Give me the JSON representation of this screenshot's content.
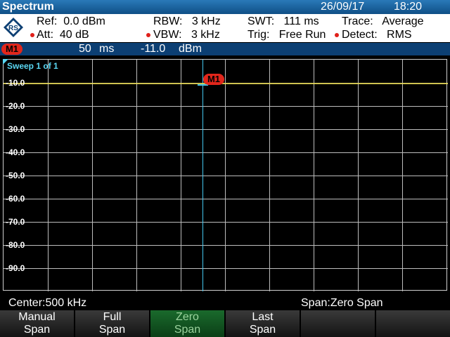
{
  "header": {
    "title": "Spectrum",
    "date": "26/09/17",
    "time": "18:20"
  },
  "settings": {
    "ref": "Ref:  0.0 dBm",
    "att": "Att:  40 dB",
    "rbw": "RBW:   3 kHz",
    "vbw": "VBW:   3 kHz",
    "swt": "SWT:   111 ms",
    "trig": "Trig:   Free Run",
    "trace": "Trace:   Average",
    "detect": "Detect:   RMS"
  },
  "marker": {
    "badge": "M1",
    "time_value": "50",
    "time_unit": "ms",
    "level_value": "-11.0",
    "level_unit": "dBm"
  },
  "plot": {
    "sweep_label": "Sweep 1 of 1",
    "y_labels": [
      "-10.0",
      "-20.0",
      "-30.0",
      "-40.0",
      "-50.0",
      "-60.0",
      "-70.0",
      "-80.0",
      "-90.0"
    ],
    "marker_label": "M1",
    "trace_color": "#f2e24a",
    "marker_line_color": "#43c6ee"
  },
  "footer": {
    "center": "Center:500 kHz",
    "span": "Span:Zero Span"
  },
  "softkeys": [
    {
      "line1": "Manual",
      "line2": "Span"
    },
    {
      "line1": "Full",
      "line2": "Span"
    },
    {
      "line1": "Zero",
      "line2": "Span",
      "active": true
    },
    {
      "line1": "Last",
      "line2": "Span"
    },
    {
      "line1": "",
      "line2": ""
    },
    {
      "line1": "",
      "line2": ""
    }
  ],
  "colors": {
    "accent_blue": "#0c3f73",
    "marker_red": "#e1261b",
    "active_key": "#1a6a2c"
  }
}
